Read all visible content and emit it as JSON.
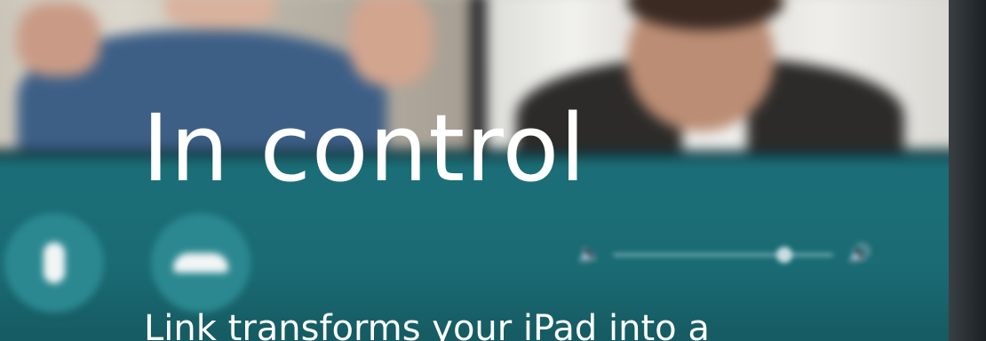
{
  "hero": {
    "headline": "In control",
    "subtext": "Link transforms your iPad into a"
  },
  "controls": {
    "mic_icon": "microphone-icon",
    "hangup_icon": "hang-up-phone-icon",
    "volume_low_icon": "volume-low-icon",
    "volume_high_icon": "volume-high-icon",
    "volume_level": 0.78
  },
  "colors": {
    "controls_bar": "#1b6f78",
    "button": "#2b8890",
    "text": "#ffffff"
  }
}
